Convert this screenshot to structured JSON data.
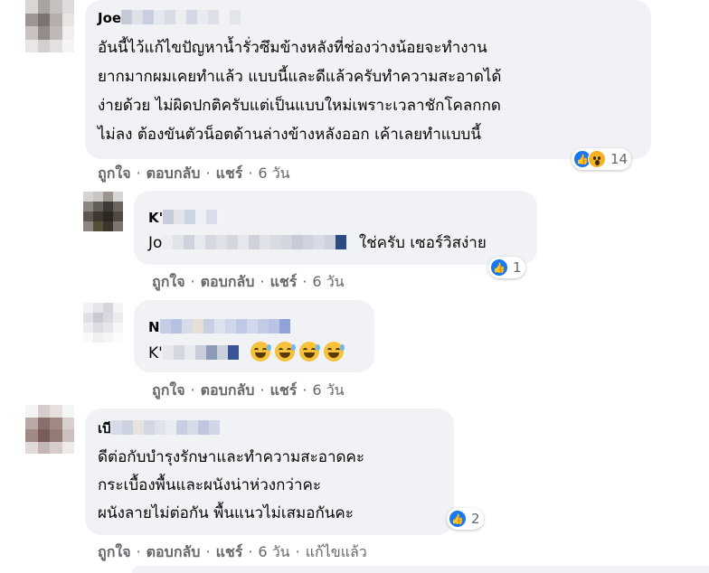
{
  "comments": [
    {
      "author_visible": "Joe",
      "lines": [
        "อันนี้ไว้แก้ไขปัญหาน้ำรั่วซึมข้างหลังที่ช่องว่างน้อยจะทำงาน",
        "ยากมากผมเคยทำแล้ว แบบนี้และดีแล้วครับทำความสะอาดได้",
        "ง่ายด้วย ไม่ผิดปกติครับแต่เป็นแบบใหม่เพราะเวลาชักโคลกกด",
        "ไม่ลง ต้องขันตัวน็อตด้านล่างข้างหลังออก เค้าเลยทำแบบนี้"
      ],
      "reaction_count": "14",
      "reaction_icons": [
        "like-icon",
        "wow-icon"
      ]
    },
    {
      "author_visible": "K'",
      "mention_visible": "Jo",
      "text": "ใช่ครับ เซอร์วิสง่าย",
      "reaction_count": "1",
      "reaction_icons": [
        "like-icon"
      ]
    },
    {
      "author_visible": "N",
      "mention_visible": "K'",
      "emoji_count": 4,
      "emoji_icon": "grinning-sweat-emoji"
    },
    {
      "author_visible": "เบี",
      "lines": [
        "ดีต่อกับบำรุงรักษาและทำความสะอาดคะ",
        "กระเบื้องพื้นและผนังน่าห่วงกว่าคะ",
        "ผนังลายไม่ต่อกัน พื้นแนวไม่เสมอกันคะ"
      ],
      "reaction_count": "2",
      "reaction_icons": [
        "like-icon"
      ],
      "edited_label": "แก้ไขแล้ว"
    }
  ],
  "actions": {
    "like": "ถูกใจ",
    "reply": "ตอบกลับ",
    "share": "แชร์",
    "separator": "·",
    "time": "6 วัน"
  },
  "colors": {
    "bubble": "#f0f2f5",
    "meta_text": "#65676b",
    "like_blue": "#1877f2",
    "wow_yellow": "#f7b125"
  }
}
